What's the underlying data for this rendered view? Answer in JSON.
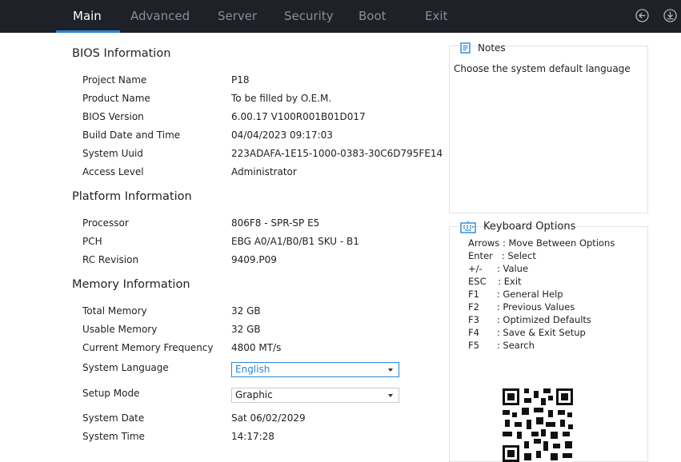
{
  "tabs": [
    {
      "label": "Main",
      "active": true
    },
    {
      "label": "Advanced",
      "active": false
    },
    {
      "label": "Server",
      "active": false
    },
    {
      "label": "Security",
      "active": false
    },
    {
      "label": "Boot",
      "active": false
    },
    {
      "label": "Exit",
      "active": false
    }
  ],
  "icons": {
    "back": "back-arrow-circle-icon",
    "save": "download-circle-icon",
    "notes": "notes-icon",
    "keyboard": "keyboard-icon",
    "qr": "qr-code-icon"
  },
  "colors": {
    "accent": "#2a86d6",
    "topbar": "#1f2128"
  },
  "bios": {
    "title": "BIOS Information",
    "rows": [
      {
        "label": "Project Name",
        "value": "P18"
      },
      {
        "label": "Product Name",
        "value": "To be filled by O.E.M."
      },
      {
        "label": "BIOS Version",
        "value": "6.00.17 V100R001B01D017"
      },
      {
        "label": "Build Date and Time",
        "value": "04/04/2023 09:17:03"
      },
      {
        "label": "System Uuid",
        "value": "223ADAFA-1E15-1000-0383-30C6D795FE14"
      },
      {
        "label": "Access Level",
        "value": "Administrator"
      }
    ]
  },
  "platform": {
    "title": "Platform Information",
    "rows": [
      {
        "label": "Processor",
        "value": "806F8 - SPR-SP E5"
      },
      {
        "label": "PCH",
        "value": "EBG A0/A1/B0/B1 SKU - B1"
      },
      {
        "label": "RC Revision",
        "value": "9409.P09"
      }
    ]
  },
  "memory": {
    "title": "Memory Information",
    "rows": [
      {
        "label": "Total Memory",
        "value": "32 GB"
      },
      {
        "label": "Usable Memory",
        "value": "32 GB"
      },
      {
        "label": "Current Memory Frequency",
        "value": "4800 MT/s"
      }
    ]
  },
  "settings": {
    "language": {
      "label": "System Language",
      "value": "English"
    },
    "setup_mode": {
      "label": "Setup Mode",
      "value": "Graphic"
    },
    "date": {
      "label": "System Date",
      "value": "Sat 06/02/2029"
    },
    "time": {
      "label": "System Time",
      "value": "14:17:28"
    }
  },
  "notes": {
    "title": "Notes",
    "text": "Choose the system default language"
  },
  "keyboard": {
    "title": "Keyboard Options",
    "lines": [
      "Arrows : Move Between Options",
      "Enter   : Select",
      "+/-     : Value",
      "ESC    : Exit",
      "F1      : General Help",
      "F2      : Previous Values",
      "F3      : Optimized Defaults",
      "F4      : Save & Exit Setup",
      "F5      : Search"
    ]
  }
}
